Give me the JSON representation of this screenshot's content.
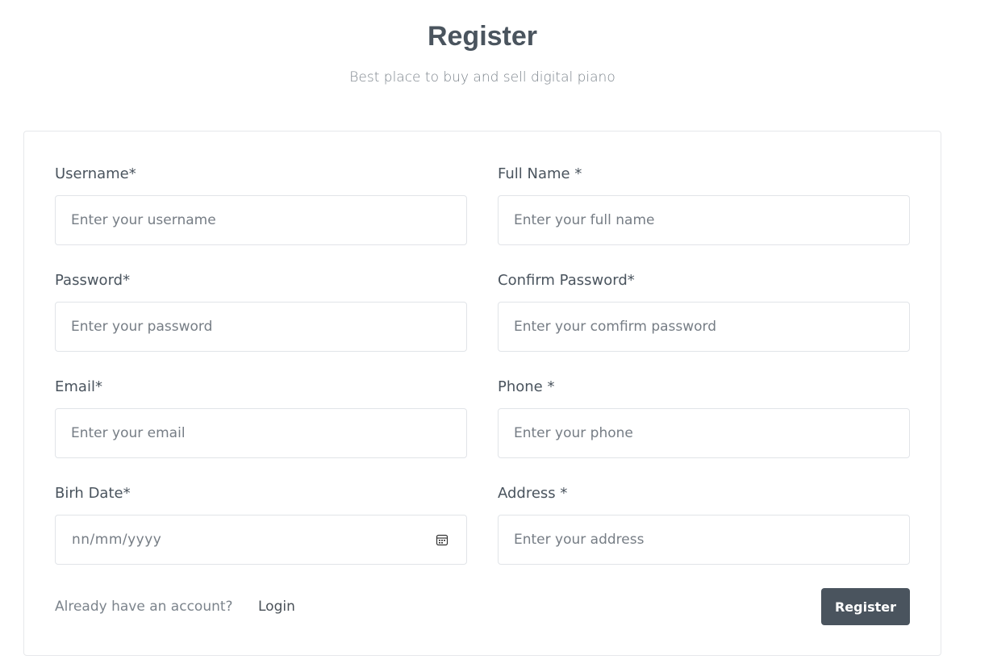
{
  "header": {
    "title": "Register",
    "subtitle": "Best place to buy and sell digital piano"
  },
  "form": {
    "username": {
      "label": "Username*",
      "placeholder": "Enter your username",
      "value": ""
    },
    "full_name": {
      "label": "Full Name *",
      "placeholder": "Enter your full name",
      "value": ""
    },
    "password": {
      "label": "Password*",
      "placeholder": "Enter your password",
      "value": ""
    },
    "confirm_password": {
      "label": "Confirm Password*",
      "placeholder": "Enter your comfirm password",
      "value": ""
    },
    "email": {
      "label": "Email*",
      "placeholder": "Enter your email",
      "value": ""
    },
    "phone": {
      "label": "Phone *",
      "placeholder": "Enter your phone",
      "value": ""
    },
    "birth_date": {
      "label": "Birh Date*",
      "display_value": "nn/mm/yyyy",
      "icon": "calendar-icon"
    },
    "address": {
      "label": "Address *",
      "placeholder": "Enter your address",
      "value": ""
    }
  },
  "footer": {
    "prompt_text": "Already have an account?",
    "login_label": "Login",
    "register_label": "Register"
  },
  "colors": {
    "primary": "#4a545e",
    "border": "#e1e4e8",
    "muted_text": "#7c848c",
    "background": "#ffffff"
  }
}
